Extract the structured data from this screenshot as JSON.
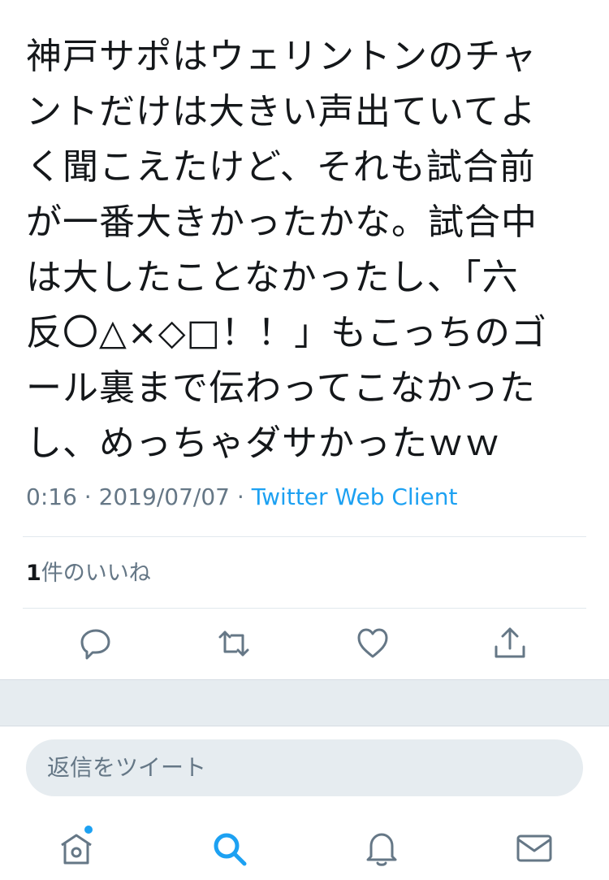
{
  "tweet": {
    "text": "神戸サポはウェリントンのチャ\nントだけは大きい声出ていてよ\nく聞こえたけど、それも試合前\nが一番大きかったかな。試合中\nは大したことなかったし、「六\n反〇△×◇□！！」もこっちのゴ\nール裏まで伝わってこなかった\nし、めっちゃダサかったｗｗ",
    "time": "0:16",
    "separator1": " · ",
    "date": "2019/07/07",
    "separator2": " · ",
    "client": "Twitter Web Client"
  },
  "likes": {
    "count": "1",
    "label": "件のいいね"
  },
  "actions": {
    "reply_icon": "reply-icon",
    "retweet_icon": "retweet-icon",
    "like_icon": "heart-icon",
    "share_icon": "share-icon"
  },
  "reply_box": {
    "placeholder": "返信をツイート"
  },
  "tabbar": {
    "items": [
      "home-icon",
      "search-icon",
      "notifications-icon",
      "messages-icon"
    ]
  },
  "colors": {
    "accent": "#1da1f2",
    "secondary_text": "#657786",
    "icon_gray": "#657786",
    "divider": "#e1e8ed",
    "band": "#e6ecf0"
  }
}
